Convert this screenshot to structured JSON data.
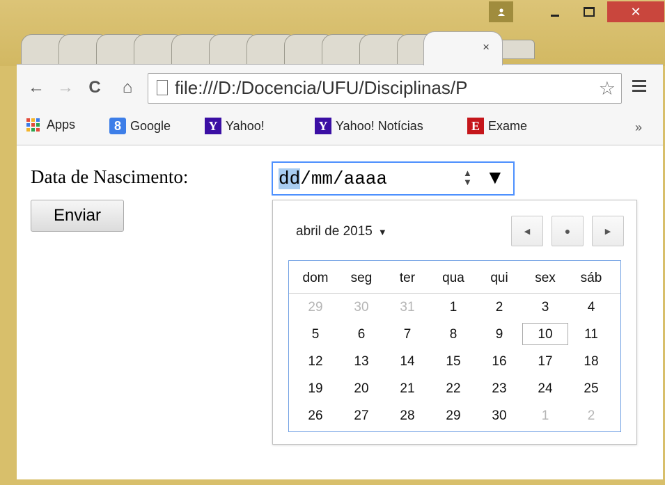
{
  "window": {
    "close_glyph": "✕"
  },
  "tab": {
    "close_glyph": "×"
  },
  "toolbar": {
    "back_glyph": "←",
    "forward_glyph": "→",
    "reload_glyph": "C",
    "home_glyph": "⌂",
    "url": "file:///D:/Docencia/UFU/Disciplinas/P",
    "star_glyph": "☆"
  },
  "bookmarks": {
    "items": [
      {
        "label": "Apps"
      },
      {
        "label": "Google",
        "logo": "8"
      },
      {
        "label": "Yahoo!",
        "logo": "Y"
      },
      {
        "label": "Yahoo! Notícias",
        "logo": "Y"
      },
      {
        "label": "Exame",
        "logo": "E"
      }
    ],
    "more": "»"
  },
  "form": {
    "label": "Data de Nascimento:",
    "date_dd": "dd",
    "date_rest": "/mm/aaaa",
    "submit_label": "Enviar"
  },
  "calendar": {
    "month_label": "abril de 2015",
    "weekdays": [
      "dom",
      "seg",
      "ter",
      "qua",
      "qui",
      "sex",
      "sáb"
    ],
    "weeks": [
      [
        {
          "d": "29",
          "o": true
        },
        {
          "d": "30",
          "o": true
        },
        {
          "d": "31",
          "o": true
        },
        {
          "d": "1"
        },
        {
          "d": "2"
        },
        {
          "d": "3"
        },
        {
          "d": "4"
        }
      ],
      [
        {
          "d": "5"
        },
        {
          "d": "6"
        },
        {
          "d": "7"
        },
        {
          "d": "8"
        },
        {
          "d": "9"
        },
        {
          "d": "10",
          "today": true
        },
        {
          "d": "11"
        }
      ],
      [
        {
          "d": "12"
        },
        {
          "d": "13"
        },
        {
          "d": "14"
        },
        {
          "d": "15"
        },
        {
          "d": "16"
        },
        {
          "d": "17"
        },
        {
          "d": "18"
        }
      ],
      [
        {
          "d": "19"
        },
        {
          "d": "20"
        },
        {
          "d": "21"
        },
        {
          "d": "22"
        },
        {
          "d": "23"
        },
        {
          "d": "24"
        },
        {
          "d": "25"
        }
      ],
      [
        {
          "d": "26"
        },
        {
          "d": "27"
        },
        {
          "d": "28"
        },
        {
          "d": "29"
        },
        {
          "d": "30"
        },
        {
          "d": "1",
          "o": true
        },
        {
          "d": "2",
          "o": true
        }
      ]
    ]
  },
  "colors": {
    "window_frame": "#d8bf6b",
    "close_button": "#c9463d",
    "focus_border": "#4d90fe",
    "date_selection": "#a8cdf1"
  }
}
